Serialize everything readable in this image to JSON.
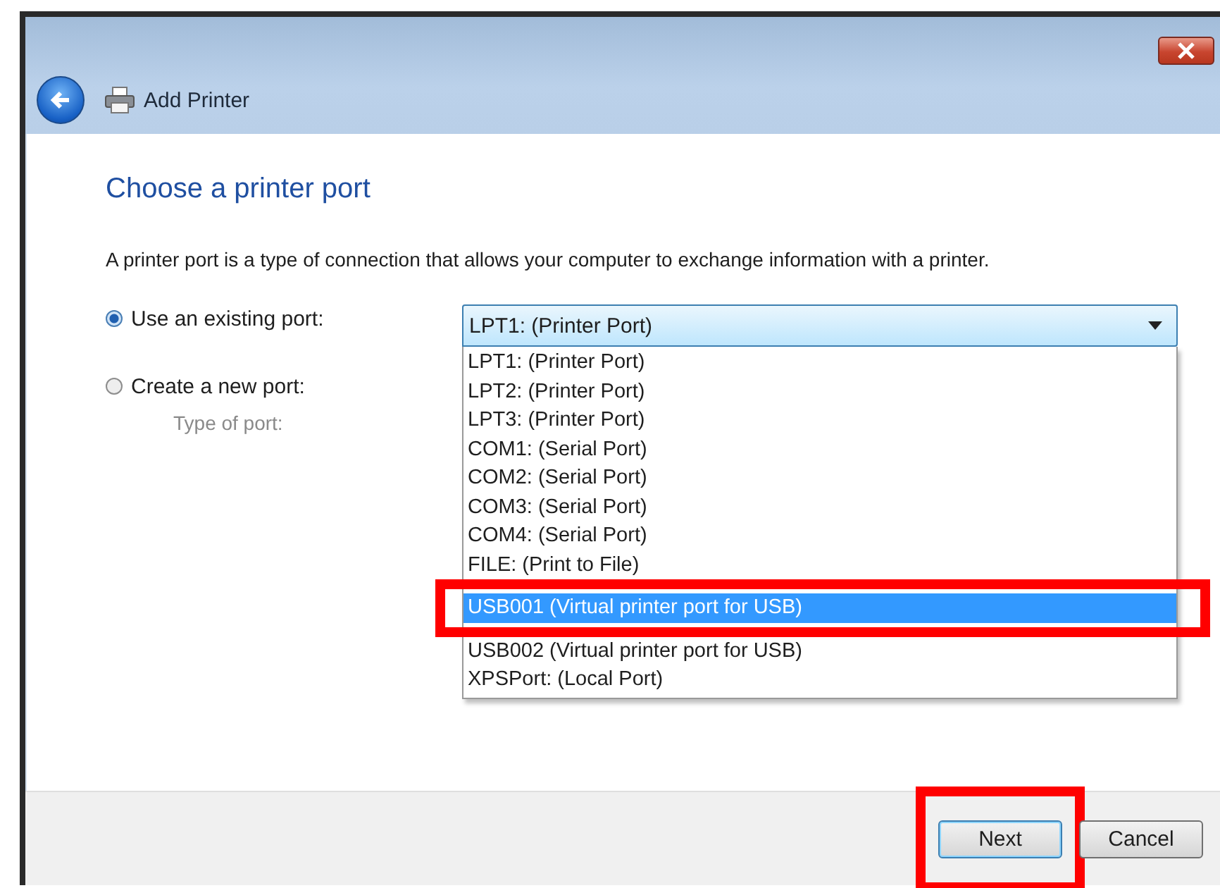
{
  "window": {
    "title": "Add Printer"
  },
  "heading": "Choose a printer port",
  "description": "A printer port is a type of connection that allows your computer to exchange information with a printer.",
  "options": [
    {
      "label": "Use an existing port:",
      "selected": true
    },
    {
      "label": "Create a new port:",
      "selected": false
    }
  ],
  "type_of_port_label": "Type of port:",
  "port_dropdown": {
    "value": "LPT1: (Printer Port)",
    "expanded": true
  },
  "port_list": [
    {
      "label": "LPT1: (Printer Port)",
      "selected": false,
      "highlighted": false
    },
    {
      "label": "LPT2: (Printer Port)",
      "selected": false,
      "highlighted": false
    },
    {
      "label": "LPT3: (Printer Port)",
      "selected": false,
      "highlighted": false
    },
    {
      "label": "COM1: (Serial Port)",
      "selected": false,
      "highlighted": false
    },
    {
      "label": "COM2: (Serial Port)",
      "selected": false,
      "highlighted": false
    },
    {
      "label": "COM3: (Serial Port)",
      "selected": false,
      "highlighted": false
    },
    {
      "label": "COM4: (Serial Port)",
      "selected": false,
      "highlighted": false
    },
    {
      "label": "FILE: (Print to File)",
      "selected": false,
      "highlighted": false
    },
    {
      "label": "USB001 (Virtual printer port for USB)",
      "selected": true,
      "highlighted": true
    },
    {
      "label": "USB002 (Virtual printer port for USB)",
      "selected": false,
      "highlighted": false
    },
    {
      "label": "XPSPort: (Local Port)",
      "selected": false,
      "highlighted": false
    }
  ],
  "buttons": [
    {
      "label": "Next",
      "default": true,
      "highlighted": true
    },
    {
      "label": "Cancel",
      "default": false,
      "highlighted": false
    }
  ]
}
